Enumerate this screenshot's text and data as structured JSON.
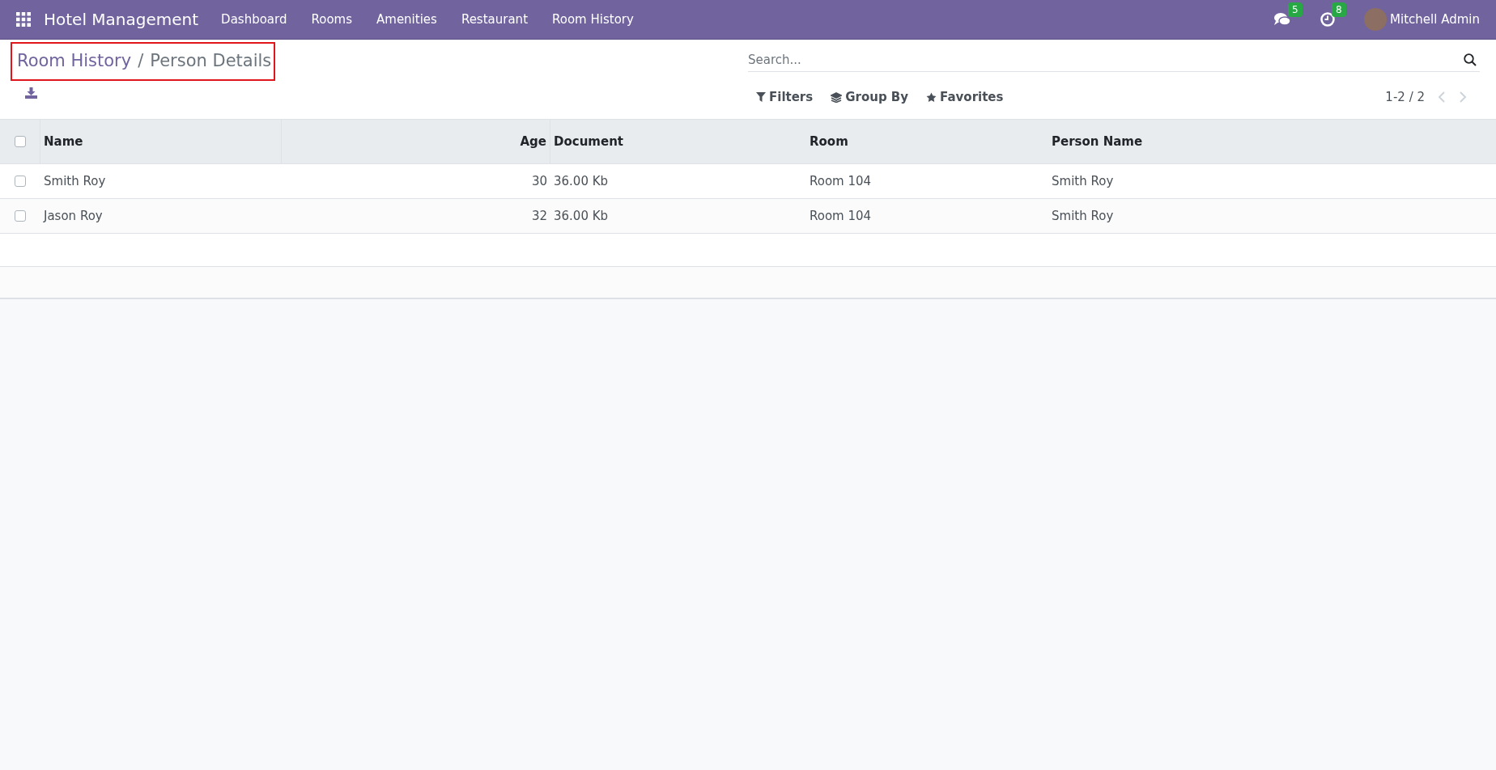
{
  "navbar": {
    "app_name": "Hotel Management",
    "menu": [
      "Dashboard",
      "Rooms",
      "Amenities",
      "Restaurant",
      "Room History"
    ],
    "messages_badge": "5",
    "activities_badge": "8",
    "user": "Mitchell Admin"
  },
  "breadcrumb": {
    "parent": "Room History",
    "separator": "/",
    "current": "Person Details"
  },
  "search": {
    "placeholder": "Search..."
  },
  "filters": [
    "Filters",
    "Group By",
    "Favorites"
  ],
  "pager": "1-2 / 2",
  "table": {
    "columns": [
      {
        "label": "Name",
        "kind": "text"
      },
      {
        "label": "Age",
        "kind": "number"
      },
      {
        "label": "Document",
        "kind": "text"
      },
      {
        "label": "Room",
        "kind": "text"
      },
      {
        "label": "Person Name",
        "kind": "text"
      }
    ],
    "rows": [
      {
        "checked": false,
        "cells": [
          "Smith Roy",
          "30",
          "36.00 Kb",
          "Room 104",
          "Smith Roy"
        ]
      },
      {
        "checked": false,
        "cells": [
          "Jason Roy",
          "32",
          "36.00 Kb",
          "Room 104",
          "Smith Roy"
        ]
      }
    ],
    "header_checked": false
  }
}
